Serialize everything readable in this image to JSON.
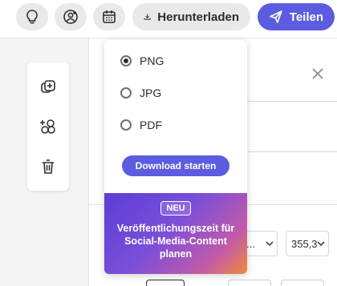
{
  "toolbar": {
    "download_label": "Herunterladen",
    "share_label": "Teilen",
    "icons": [
      "lightbulb-icon",
      "user-add-icon",
      "calendar-icon",
      "download-icon",
      "send-icon"
    ]
  },
  "tools": [
    "duplicate-icon",
    "arrange-icon",
    "trash-icon"
  ],
  "download_menu": {
    "options": [
      {
        "label": "PNG",
        "selected": true
      },
      {
        "label": "JPG",
        "selected": false
      },
      {
        "label": "PDF",
        "selected": false
      }
    ],
    "start_label": "Download starten",
    "promo": {
      "badge": "NEU",
      "text": "Veröffentlichungszeit für Social-Media-Content planen"
    }
  },
  "fields": {
    "dim_partial": "...",
    "dim_value": "355,3"
  },
  "colors": {
    "accent": "#5c5ce0",
    "toolbar_button": "#e9e9e9"
  }
}
